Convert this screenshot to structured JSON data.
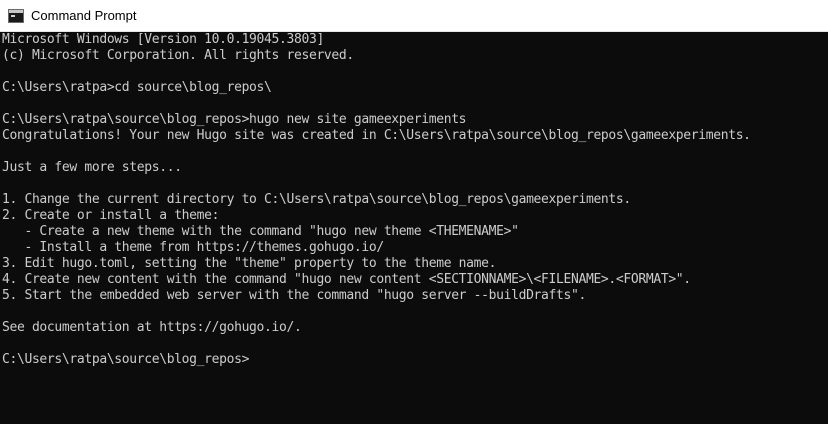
{
  "window": {
    "title": "Command Prompt",
    "app_icon": "cmd-icon",
    "colors": {
      "console_background": "#0c0c0c",
      "console_text": "#cccccc",
      "titlebar_background": "#ffffff"
    }
  },
  "console": {
    "lines": [
      "Microsoft Windows [Version 10.0.19045.3803]",
      "(c) Microsoft Corporation. All rights reserved.",
      "",
      "C:\\Users\\ratpa>cd source\\blog_repos\\",
      "",
      "C:\\Users\\ratpa\\source\\blog_repos>hugo new site gameexperiments",
      "Congratulations! Your new Hugo site was created in C:\\Users\\ratpa\\source\\blog_repos\\gameexperiments.",
      "",
      "Just a few more steps...",
      "",
      "1. Change the current directory to C:\\Users\\ratpa\\source\\blog_repos\\gameexperiments.",
      "2. Create or install a theme:",
      "   - Create a new theme with the command \"hugo new theme <THEMENAME>\"",
      "   - Install a theme from https://themes.gohugo.io/",
      "3. Edit hugo.toml, setting the \"theme\" property to the theme name.",
      "4. Create new content with the command \"hugo new content <SECTIONNAME>\\<FILENAME>.<FORMAT>\".",
      "5. Start the embedded web server with the command \"hugo server --buildDrafts\".",
      "",
      "See documentation at https://gohugo.io/.",
      "",
      "C:\\Users\\ratpa\\source\\blog_repos>"
    ]
  }
}
